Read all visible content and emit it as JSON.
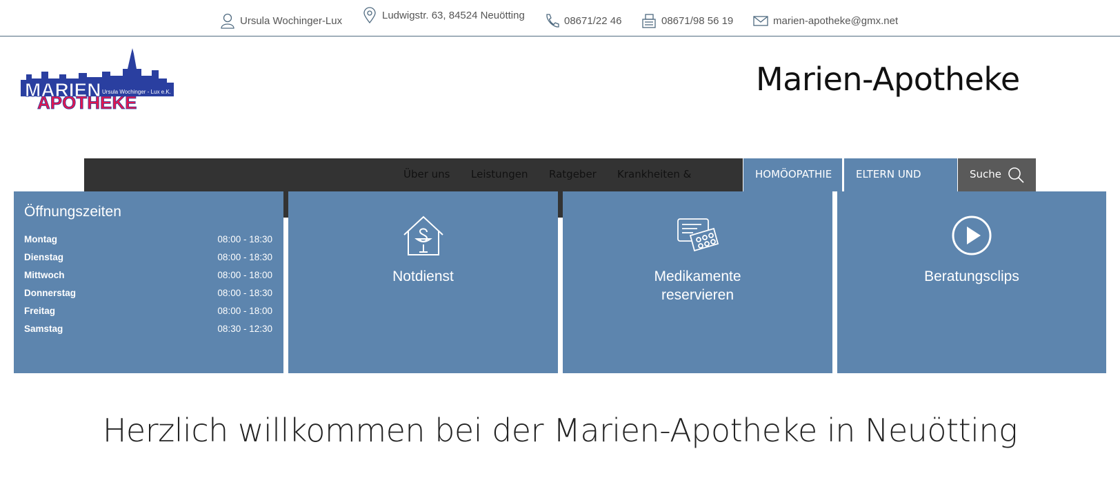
{
  "contact": {
    "owner": "Ursula Wochinger-Lux",
    "address": "Ludwigstr. 63, 84524 Neuötting",
    "phone": "08671/22 46",
    "fax": "08671/98 56 19",
    "email": "marien-apotheke@gmx.net"
  },
  "logo": {
    "line1": "MARIEN",
    "line2": "APOTHEKE",
    "owner": "Ursula Wochinger - Lux e.K."
  },
  "header": {
    "title": "Marien-Apotheke"
  },
  "nav": {
    "items": [
      "Über uns",
      "Leistungen",
      "Ratgeber",
      "Krankheiten &"
    ],
    "tab_homoeopathie": "HOMÖOPATHIE",
    "tab_eltern": "ELTERN UND",
    "search": "Suche"
  },
  "hours": {
    "title": "Öffnungszeiten",
    "rows": [
      {
        "day": "Montag",
        "time": "08:00 - 18:30"
      },
      {
        "day": "Dienstag",
        "time": "08:00 - 18:30"
      },
      {
        "day": "Mittwoch",
        "time": "08:00 - 18:00"
      },
      {
        "day": "Donnerstag",
        "time": "08:00 - 18:30"
      },
      {
        "day": "Freitag",
        "time": "08:00 - 18:00"
      },
      {
        "day": "Samstag",
        "time": "08:30 - 12:30"
      }
    ]
  },
  "tiles": {
    "notdienst": "Notdienst",
    "medikamente_line1": "Medikamente",
    "medikamente_line2": "reservieren",
    "clips": "Beratungsclips"
  },
  "welcome": "Herzlich willkommen bei der Marien-Apotheke in Neuötting",
  "colors": {
    "tile": "#5d85ae",
    "navbar": "#333333",
    "search": "#5a5a5a",
    "logo_blue": "#2a3fa0",
    "logo_red": "#e4174f"
  }
}
